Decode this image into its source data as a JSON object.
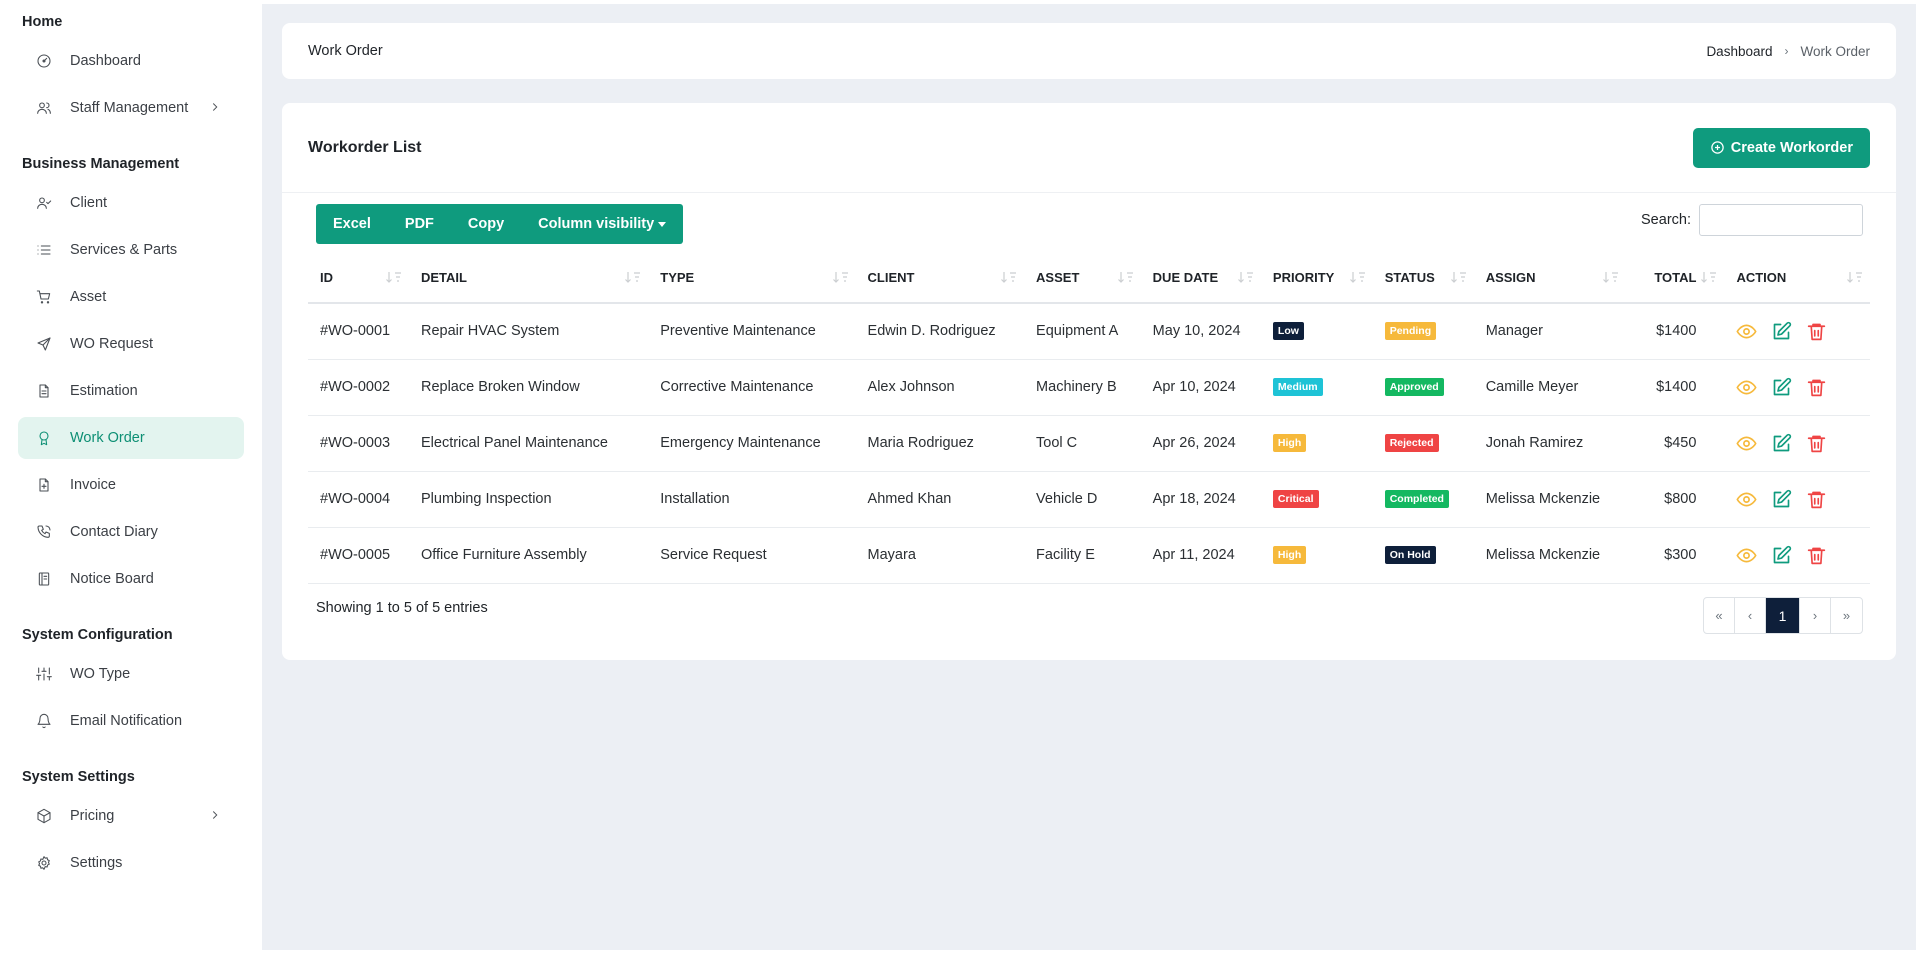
{
  "sidebar": {
    "sections": [
      {
        "heading": "Home",
        "items": [
          {
            "label": "Dashboard",
            "icon": "dashboard-icon"
          },
          {
            "label": "Staff Management",
            "icon": "users-icon",
            "has_chevron": true
          }
        ]
      },
      {
        "heading": "Business Management",
        "items": [
          {
            "label": "Client",
            "icon": "user-check-icon"
          },
          {
            "label": "Services & Parts",
            "icon": "list-icon"
          },
          {
            "label": "Asset",
            "icon": "cart-icon"
          },
          {
            "label": "WO Request",
            "icon": "send-icon"
          },
          {
            "label": "Estimation",
            "icon": "file-text-icon"
          },
          {
            "label": "Work Order",
            "icon": "award-icon",
            "active": true
          },
          {
            "label": "Invoice",
            "icon": "file-plus-icon"
          },
          {
            "label": "Contact Diary",
            "icon": "phone-icon"
          },
          {
            "label": "Notice Board",
            "icon": "notebook-icon"
          }
        ]
      },
      {
        "heading": "System Configuration",
        "items": [
          {
            "label": "WO Type",
            "icon": "sliders-icon"
          },
          {
            "label": "Email Notification",
            "icon": "bell-icon"
          }
        ]
      },
      {
        "heading": "System Settings",
        "items": [
          {
            "label": "Pricing",
            "icon": "package-icon",
            "has_chevron": true
          },
          {
            "label": "Settings",
            "icon": "gear-icon"
          }
        ]
      }
    ]
  },
  "header": {
    "title": "Work Order",
    "breadcrumb": [
      "Dashboard",
      "Work Order"
    ]
  },
  "card": {
    "title": "Workorder List",
    "create_label": "Create Workorder"
  },
  "toolbar": {
    "buttons": [
      "Excel",
      "PDF",
      "Copy",
      "Column visibility"
    ]
  },
  "search": {
    "label": "Search:",
    "value": ""
  },
  "table": {
    "columns": [
      "ID",
      "DETAIL",
      "TYPE",
      "CLIENT",
      "ASSET",
      "DUE DATE",
      "PRIORITY",
      "STATUS",
      "ASSIGN",
      "TOTAL",
      "ACTION"
    ],
    "rows": [
      {
        "id": "#WO-0001",
        "detail": "Repair HVAC System",
        "type": "Preventive Maintenance",
        "client": "Edwin D. Rodriguez",
        "asset": "Equipment A",
        "due": "May 10, 2024",
        "priority": "Low",
        "status": "Pending",
        "assign": "Manager",
        "total": "$1400"
      },
      {
        "id": "#WO-0002",
        "detail": "Replace Broken Window",
        "type": "Corrective Maintenance",
        "client": "Alex Johnson",
        "asset": "Machinery B",
        "due": "Apr 10, 2024",
        "priority": "Medium",
        "status": "Approved",
        "assign": "Camille Meyer",
        "total": "$1400"
      },
      {
        "id": "#WO-0003",
        "detail": "Electrical Panel Maintenance",
        "type": "Emergency Maintenance",
        "client": "Maria Rodriguez",
        "asset": "Tool C",
        "due": "Apr 26, 2024",
        "priority": "High",
        "status": "Rejected",
        "assign": "Jonah Ramirez",
        "total": "$450"
      },
      {
        "id": "#WO-0004",
        "detail": "Plumbing Inspection",
        "type": "Installation",
        "client": "Ahmed Khan",
        "asset": "Vehicle D",
        "due": "Apr 18, 2024",
        "priority": "Critical",
        "status": "Completed",
        "assign": "Melissa Mckenzie",
        "total": "$800"
      },
      {
        "id": "#WO-0005",
        "detail": "Office Furniture Assembly",
        "type": "Service Request",
        "client": "Mayara",
        "asset": "Facility E",
        "due": "Apr 11, 2024",
        "priority": "High",
        "status": "On Hold",
        "assign": "Melissa Mckenzie",
        "total": "$300"
      }
    ]
  },
  "badge_colors": {
    "Low": "#0e1f3a",
    "Medium": "#1ec3d6",
    "High": "#f6b93b",
    "Critical": "#ef4444",
    "Pending": "#f6b93b",
    "Approved": "#14b861",
    "Rejected": "#ef4444",
    "Completed": "#14b861",
    "On Hold": "#0e1f3a"
  },
  "action_colors": {
    "view": "#f6b93b",
    "edit": "#0f9b7e",
    "delete": "#ef4444"
  },
  "footer": {
    "info": "Showing 1 to 5 of 5 entries",
    "pager": [
      "«",
      "‹",
      "1",
      "›",
      "»"
    ],
    "current_page": "1"
  }
}
